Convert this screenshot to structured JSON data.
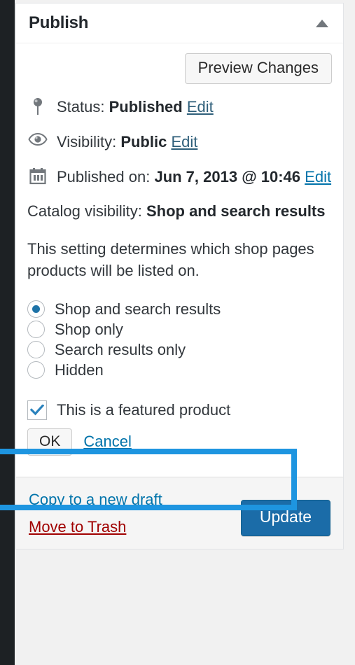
{
  "panel": {
    "title": "Publish",
    "toggle_icon": "triangle-up-icon"
  },
  "preview": {
    "label": "Preview Changes"
  },
  "status": {
    "icon": "pin-icon",
    "label": "Status:",
    "value": "Published",
    "edit_label": "Edit"
  },
  "visibility": {
    "icon": "eye-icon",
    "label": "Visibility:",
    "value": "Public",
    "edit_label": "Edit"
  },
  "published_on": {
    "icon": "calendar-icon",
    "label": "Published on:",
    "value": "Jun 7, 2013 @ 10:46",
    "edit_label": "Edit"
  },
  "catalog": {
    "label": "Catalog visibility:",
    "value": "Shop and search results",
    "description": "This setting determines which shop pages products will be listed on.",
    "options": [
      {
        "label": "Shop and search results",
        "selected": true
      },
      {
        "label": "Shop only",
        "selected": false
      },
      {
        "label": "Search results only",
        "selected": false
      },
      {
        "label": "Hidden",
        "selected": false
      }
    ],
    "featured": {
      "label": "This is a featured product",
      "checked": true,
      "icon": "checkmark-icon"
    },
    "ok_label": "OK",
    "cancel_label": "Cancel"
  },
  "footer": {
    "copy_draft_label": "Copy to a new draft",
    "trash_label": "Move to Trash",
    "update_label": "Update"
  },
  "colors": {
    "accent_blue": "#1e95e0",
    "primary_button": "#1b6ca8",
    "link": "#0073aa",
    "danger_link": "#a00000",
    "radio_dot": "#1e73a8"
  }
}
